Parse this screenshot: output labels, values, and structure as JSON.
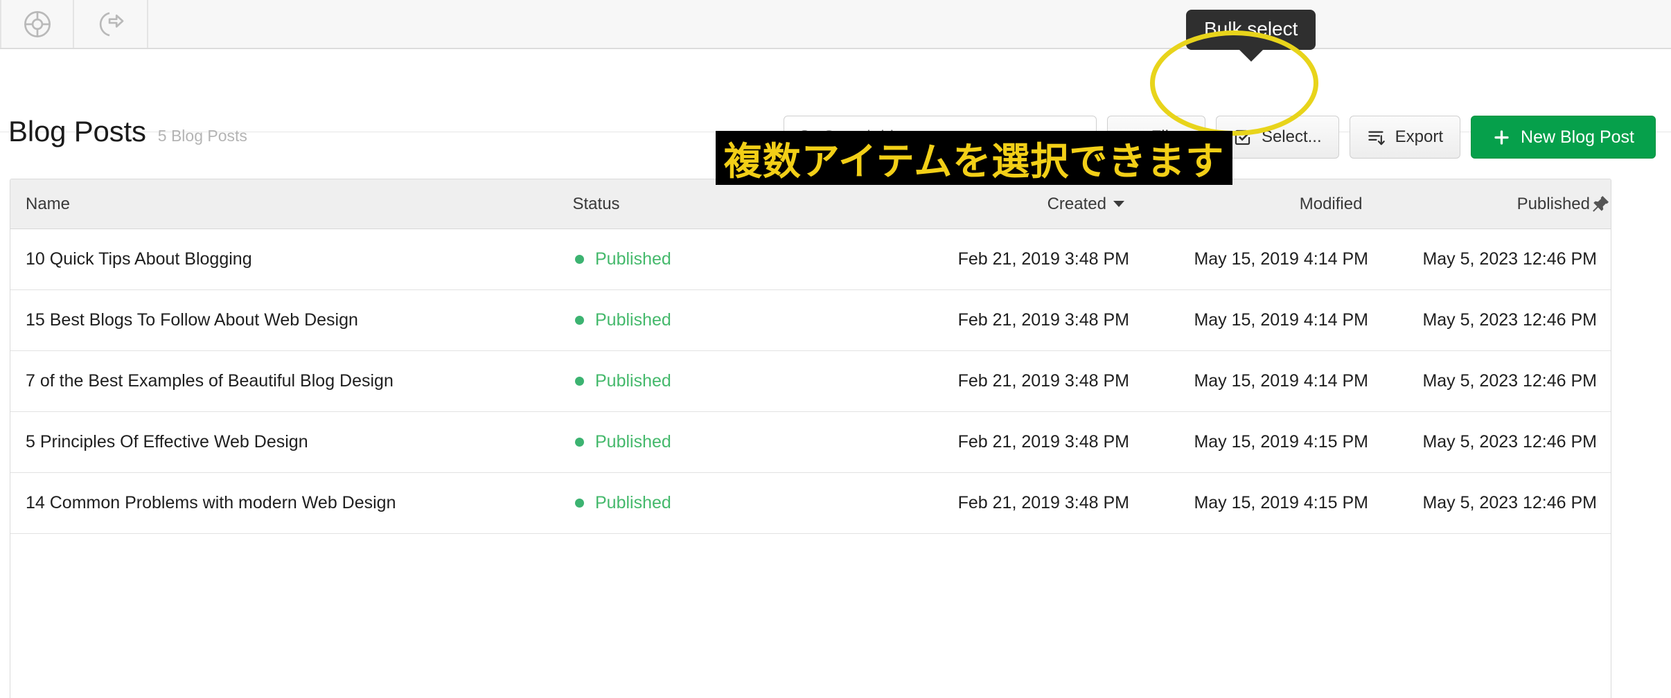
{
  "topbar": {
    "icons": [
      {
        "name": "lifebuoy-icon",
        "label": "Help"
      },
      {
        "name": "sign-out-icon",
        "label": "Sign out"
      }
    ]
  },
  "header": {
    "title": "Blog Posts",
    "subtitle": "5 Blog Posts"
  },
  "search": {
    "placeholder": "Search blog posts...",
    "value": "",
    "icon": "search-icon"
  },
  "toolbar": {
    "filter_label": "Filter",
    "filter_icon": "funnel-icon",
    "select_label": "Select...",
    "select_icon": "checkbox-checked-icon",
    "export_label": "Export",
    "export_icon": "export-list-icon",
    "new_label": "New Blog Post",
    "new_icon": "plus-icon",
    "primary_color": "#06a04b"
  },
  "annotations": {
    "tooltip_text": "Bulk select",
    "caption_text": "複数アイテムを選択できます",
    "highlight_color": "#e8d41b",
    "caption_text_color": "#f2cf17",
    "caption_bg_color": "#000000"
  },
  "table": {
    "columns": {
      "name": "Name",
      "status": "Status",
      "created": "Created",
      "modified": "Modified",
      "published": "Published",
      "pin": "pin-icon"
    },
    "sort": {
      "column": "Created",
      "direction": "desc",
      "icon": "caret-down-icon"
    },
    "status_dot_color": "#3cb371",
    "status_text_color": "#45b96c",
    "rows": [
      {
        "name": "10 Quick Tips About Blogging",
        "status": "Published",
        "created": "Feb 21, 2019 3:48 PM",
        "modified": "May 15, 2019 4:14 PM",
        "published": "May 5, 2023 12:46 PM"
      },
      {
        "name": "15 Best Blogs To Follow About Web Design",
        "status": "Published",
        "created": "Feb 21, 2019 3:48 PM",
        "modified": "May 15, 2019 4:14 PM",
        "published": "May 5, 2023 12:46 PM"
      },
      {
        "name": "7 of the Best Examples of Beautiful Blog Design",
        "status": "Published",
        "created": "Feb 21, 2019 3:48 PM",
        "modified": "May 15, 2019 4:14 PM",
        "published": "May 5, 2023 12:46 PM"
      },
      {
        "name": "5 Principles Of Effective Web Design",
        "status": "Published",
        "created": "Feb 21, 2019 3:48 PM",
        "modified": "May 15, 2019 4:15 PM",
        "published": "May 5, 2023 12:46 PM"
      },
      {
        "name": "14 Common Problems with modern Web Design",
        "status": "Published",
        "created": "Feb 21, 2019 3:48 PM",
        "modified": "May 15, 2019 4:15 PM",
        "published": "May 5, 2023 12:46 PM"
      }
    ]
  }
}
